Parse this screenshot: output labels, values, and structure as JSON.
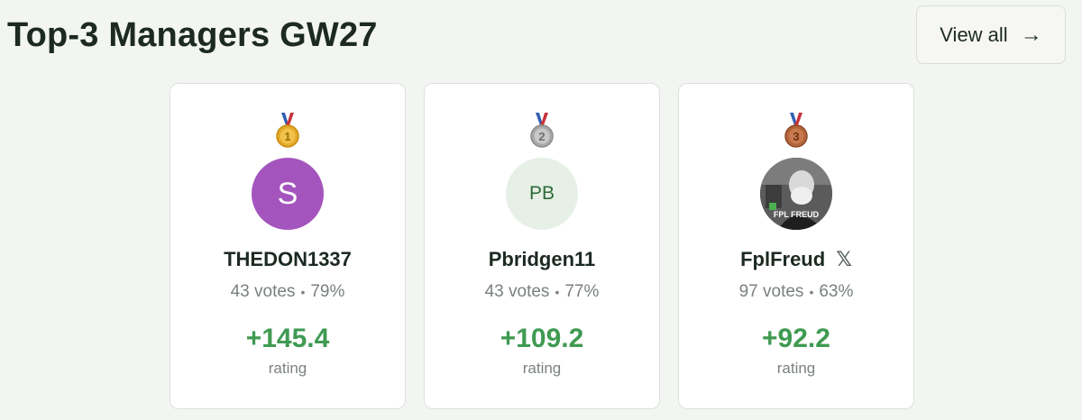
{
  "header": {
    "title": "Top-3 Managers GW27",
    "view_all_label": "View all"
  },
  "managers": [
    {
      "rank": "1",
      "avatar_text": "S",
      "name": "THEDON1337",
      "votes": "43 votes",
      "percent": "79%",
      "rating": "+145.4",
      "rating_label": "rating"
    },
    {
      "rank": "2",
      "avatar_text": "PB",
      "name": "Pbridgen11",
      "votes": "43 votes",
      "percent": "77%",
      "rating": "+109.2",
      "rating_label": "rating"
    },
    {
      "rank": "3",
      "avatar_caption": "FPL FREUD",
      "name": "FplFreud",
      "social_icon": "x-icon",
      "votes": "97 votes",
      "percent": "63%",
      "rating": "+92.2",
      "rating_label": "rating"
    }
  ],
  "colors": {
    "rating_green": "#3f9a52",
    "gold": "#e3a92a",
    "silver": "#a9a9a9",
    "bronze": "#b3643a"
  }
}
